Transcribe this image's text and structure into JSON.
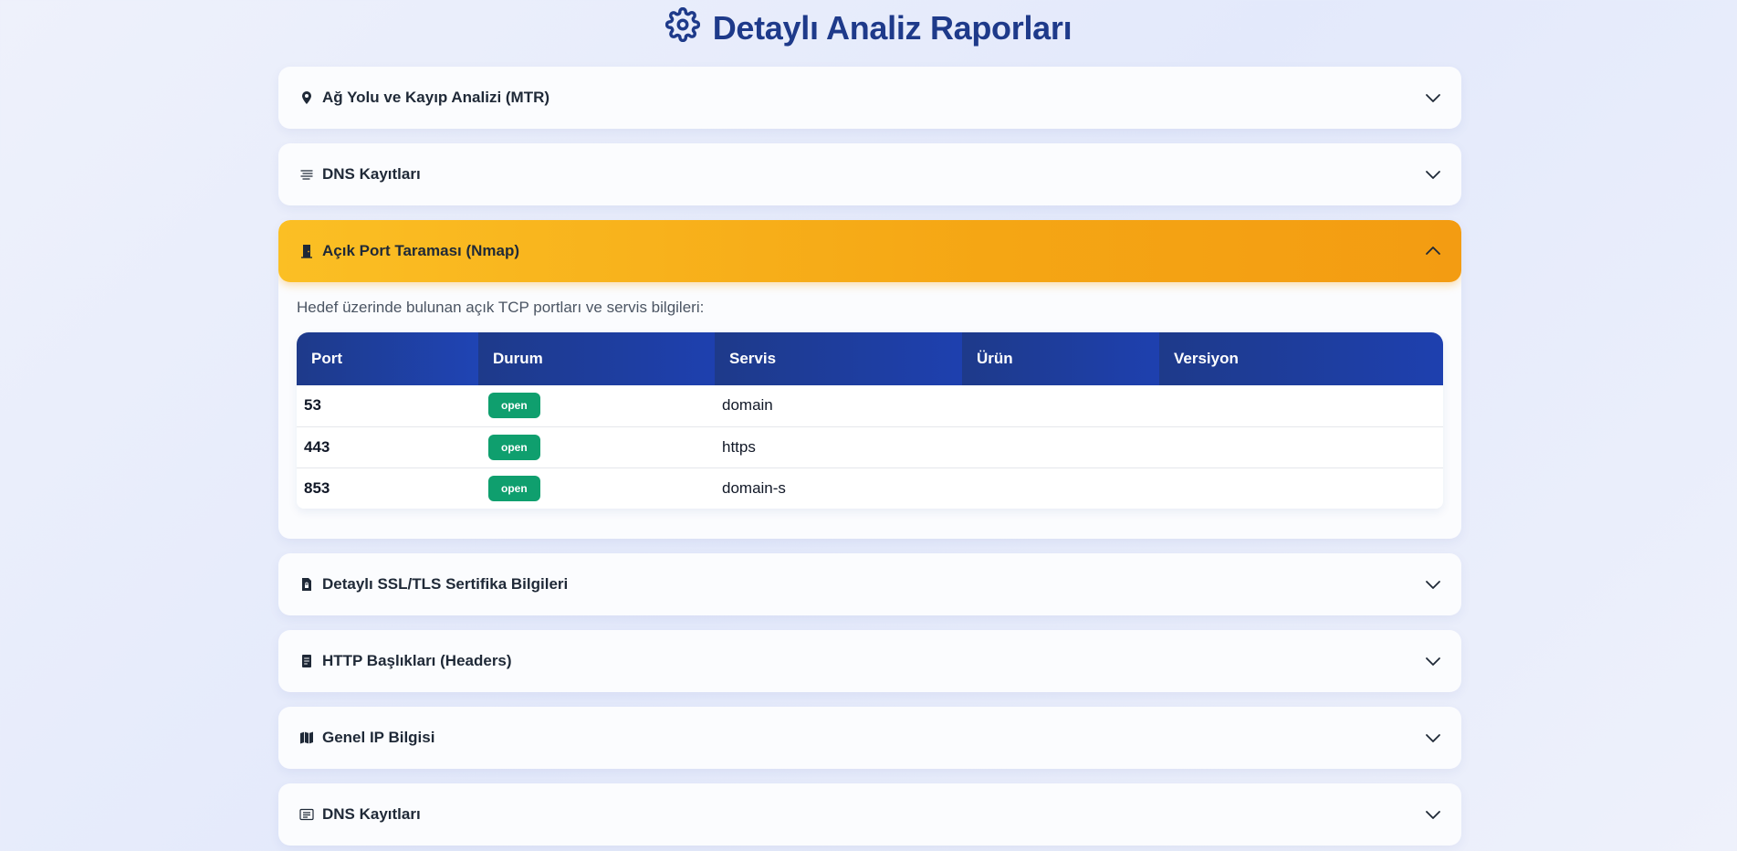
{
  "header": {
    "title": "Detaylı Analiz Raporları",
    "icon": "gear-icon"
  },
  "accent_color": "#f5a614",
  "sections": [
    {
      "title": "Ağ Yolu ve Kayıp Analizi (MTR)",
      "icon": "map-pin-icon",
      "expanded": false
    },
    {
      "title": "DNS Kayıtları",
      "icon": "list-lines-icon",
      "expanded": false
    },
    {
      "title": "Açık Port Taraması (Nmap)",
      "icon": "door-icon",
      "expanded": true
    },
    {
      "title": "Detaylı SSL/TLS Sertifika Bilgileri",
      "icon": "file-lock-icon",
      "expanded": false
    },
    {
      "title": "HTTP Başlıkları (Headers)",
      "icon": "document-icon",
      "expanded": false
    },
    {
      "title": "Genel IP Bilgisi",
      "icon": "map-icon",
      "expanded": false
    },
    {
      "title": "DNS Kayıtları",
      "icon": "list-box-icon",
      "expanded": false
    }
  ],
  "port_scan": {
    "intro": "Hedef üzerinde bulunan açık TCP portları ve servis bilgileri:",
    "columns": [
      "Port",
      "Durum",
      "Servis",
      "Ürün",
      "Versiyon"
    ],
    "rows": [
      {
        "port": "53",
        "status": "open",
        "service": "domain",
        "product": "",
        "version": ""
      },
      {
        "port": "443",
        "status": "open",
        "service": "https",
        "product": "",
        "version": ""
      },
      {
        "port": "853",
        "status": "open",
        "service": "domain-s",
        "product": "",
        "version": ""
      }
    ]
  }
}
